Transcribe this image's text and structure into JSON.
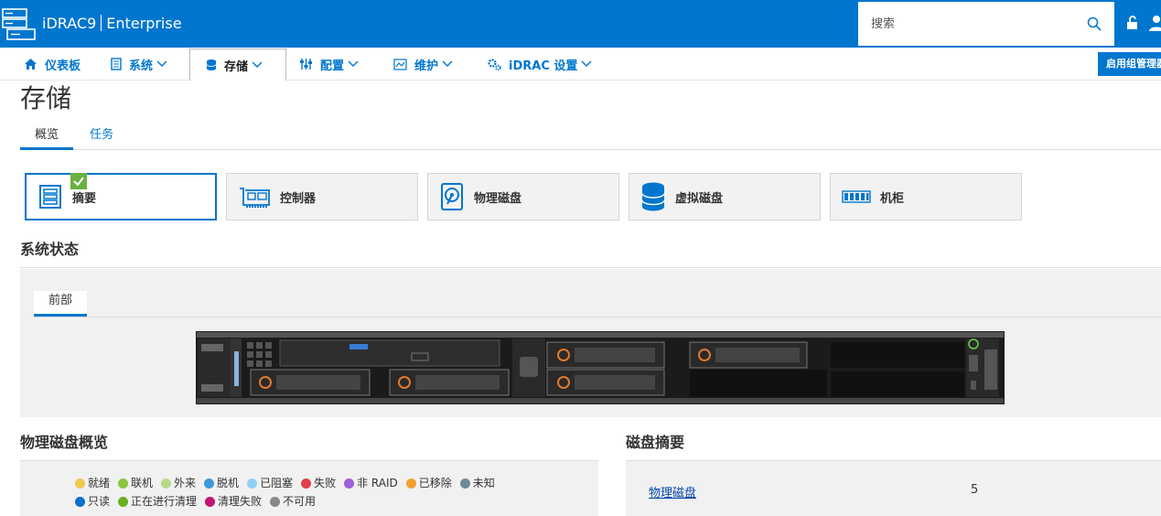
{
  "header": {
    "product": "iDRAC9",
    "edition": "Enterprise",
    "search_placeholder": "搜索"
  },
  "nav": {
    "items": [
      {
        "label": "仪表板",
        "icon": "home-icon"
      },
      {
        "label": "系统",
        "icon": "server-icon"
      },
      {
        "label": "存储",
        "icon": "database-icon",
        "active": true
      },
      {
        "label": "配置",
        "icon": "sliders-icon"
      },
      {
        "label": "维护",
        "icon": "chart-icon"
      },
      {
        "label": "iDRAC 设置",
        "icon": "gears-icon"
      }
    ],
    "group_button": "启用组管理器"
  },
  "page": {
    "title": "存储",
    "tabs": [
      "概览",
      "任务"
    ]
  },
  "cards": [
    {
      "label": "摘要",
      "icon": "summary-icon",
      "selected": true
    },
    {
      "label": "控制器",
      "icon": "controller-icon"
    },
    {
      "label": "物理磁盘",
      "icon": "physical-disk-icon"
    },
    {
      "label": "虚拟磁盘",
      "icon": "virtual-disk-icon"
    },
    {
      "label": "机柜",
      "icon": "enclosure-icon"
    }
  ],
  "system_status": {
    "heading": "系统状态",
    "tab": "前部"
  },
  "disk_overview": {
    "heading": "物理磁盘概览",
    "legend": [
      {
        "label": "就绪",
        "color": "#f0c850"
      },
      {
        "label": "联机",
        "color": "#8cc63f"
      },
      {
        "label": "外来",
        "color": "#b8d98a"
      },
      {
        "label": "脱机",
        "color": "#3a9ad9"
      },
      {
        "label": "已阻塞",
        "color": "#8fd0f0"
      },
      {
        "label": "失败",
        "color": "#e0404a"
      },
      {
        "label": "非 RAID",
        "color": "#a060d8"
      },
      {
        "label": "已移除",
        "color": "#f5a030"
      },
      {
        "label": "未知",
        "color": "#6f8a9a"
      },
      {
        "label": "只读",
        "color": "#0a70c8"
      },
      {
        "label": "正在进行清理",
        "color": "#6ab020"
      },
      {
        "label": "清理失败",
        "color": "#c01870"
      },
      {
        "label": "不可用",
        "color": "#888888"
      }
    ]
  },
  "disk_summary": {
    "heading": "磁盘摘要",
    "link": "物理磁盘",
    "count": "5"
  }
}
